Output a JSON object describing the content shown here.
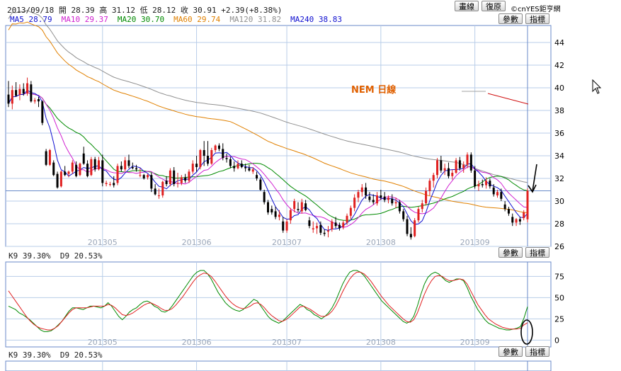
{
  "header": {
    "line1": "2013/09/18 開 28.39 高 31.12 低 28.12 收 30.91 +2.39(+8.38%)",
    "line2_items": [
      {
        "text": "MA5 28.79",
        "color": "#1010d0"
      },
      {
        "text": "MA10 29.37",
        "color": "#d020d0"
      },
      {
        "text": "MA20 30.70",
        "color": "#008a00"
      },
      {
        "text": "MA60 29.74",
        "color": "#e08000"
      },
      {
        "text": "MA120 31.82",
        "color": "#909090"
      },
      {
        "text": "MA240 38.83",
        "color": "#1010d0"
      }
    ]
  },
  "toolbar": {
    "draw_label": "畫線",
    "restore_label": "復原",
    "copyright": "©cnYES鉅亨網"
  },
  "buttons": {
    "param_label": "參數",
    "indicator_label": "指標"
  },
  "kd_header": "K9 39.30%  D9 20.53%",
  "kd_header_bottom": "K9 39.30%  D9 20.53%",
  "colors": {
    "up": "#e02020",
    "down": "#000000",
    "ma5": "#1010d0",
    "ma10": "#d020d0",
    "ma20": "#008a00",
    "ma60": "#e08000",
    "ma120": "#909090",
    "k": "#008a00",
    "d": "#e02020",
    "hline": "#6a8ac8",
    "grid": "#b8cde8",
    "annotation": "#e06000"
  },
  "chart_data": [
    {
      "type": "candlestick",
      "title": "NEM 日線",
      "x_tick_labels": [
        "201305",
        "201306",
        "201307",
        "201308",
        "201309"
      ],
      "y_tick_labels": [
        26,
        28,
        30,
        32,
        34,
        36,
        38,
        40,
        42,
        44
      ],
      "ylim": [
        26,
        45.5
      ],
      "horizontal_line": 30.91,
      "ohlc": [
        [
          39.4,
          40.6,
          38.3,
          38.6
        ],
        [
          38.6,
          40.2,
          38.1,
          39.8
        ],
        [
          39.8,
          40.5,
          39.2,
          39.3
        ],
        [
          39.4,
          40.3,
          38.9,
          39.9
        ],
        [
          39.9,
          40.4,
          39.3,
          39.5
        ],
        [
          39.5,
          40.9,
          39.3,
          40.4
        ],
        [
          40.3,
          40.6,
          38.7,
          38.8
        ],
        [
          38.8,
          39.1,
          38.6,
          38.9
        ],
        [
          39.0,
          39.2,
          38.3,
          38.8
        ],
        [
          38.8,
          38.9,
          36.7,
          36.9
        ],
        [
          34.4,
          34.6,
          33.1,
          33.2
        ],
        [
          33.2,
          34.6,
          33.1,
          34.5
        ],
        [
          33.4,
          33.6,
          32.2,
          32.3
        ],
        [
          32.4,
          32.6,
          31.1,
          31.2
        ],
        [
          31.3,
          32.7,
          31.2,
          32.6
        ],
        [
          32.6,
          33.1,
          32.2,
          32.3
        ],
        [
          32.4,
          32.7,
          32.1,
          32.6
        ],
        [
          32.6,
          33.6,
          32.4,
          33.4
        ],
        [
          33.2,
          33.5,
          32.1,
          32.2
        ],
        [
          32.3,
          33.4,
          32.2,
          33.3
        ],
        [
          34.2,
          34.8,
          33.2,
          33.3
        ],
        [
          33.3,
          33.6,
          32.1,
          32.2
        ],
        [
          32.3,
          33.9,
          32.2,
          33.7
        ],
        [
          33.7,
          33.9,
          32.6,
          32.8
        ],
        [
          32.8,
          33.9,
          32.7,
          33.6
        ],
        [
          33.6,
          34.1,
          31.3,
          31.6
        ],
        [
          31.5,
          31.8,
          31.3,
          31.6
        ],
        [
          31.5,
          31.7,
          31.3,
          31.5
        ],
        [
          31.6,
          32.2,
          31.2,
          31.4
        ],
        [
          31.6,
          33.3,
          31.4,
          33.1
        ],
        [
          33.1,
          33.5,
          32.6,
          32.8
        ],
        [
          32.8,
          33.9,
          32.6,
          33.6
        ],
        [
          33.6,
          34.1,
          32.9,
          33.1
        ],
        [
          33.0,
          33.4,
          32.8,
          32.9
        ],
        [
          32.9,
          33.2,
          32.6,
          32.8
        ],
        [
          32.3,
          32.9,
          32.1,
          32.3
        ],
        [
          32.3,
          32.4,
          31.9,
          32.0
        ],
        [
          32.1,
          32.4,
          31.9,
          32.3
        ],
        [
          32.3,
          32.5,
          30.8,
          31.1
        ],
        [
          31.1,
          31.5,
          30.5,
          30.6
        ],
        [
          30.5,
          31.1,
          30.2,
          30.5
        ],
        [
          30.5,
          31.8,
          30.3,
          31.7
        ],
        [
          31.8,
          32.2,
          31.3,
          31.5
        ],
        [
          31.5,
          32.9,
          31.3,
          32.7
        ],
        [
          32.7,
          33.0,
          31.3,
          31.5
        ],
        [
          31.6,
          32.5,
          31.2,
          31.6
        ],
        [
          31.6,
          32.3,
          31.4,
          32.1
        ],
        [
          32.1,
          32.4,
          31.6,
          31.8
        ],
        [
          31.8,
          32.8,
          31.6,
          32.6
        ],
        [
          32.6,
          33.6,
          32.4,
          33.3
        ],
        [
          33.3,
          34.0,
          32.6,
          33.0
        ],
        [
          33.0,
          34.6,
          32.8,
          34.5
        ],
        [
          34.5,
          35.3,
          33.1,
          34.0
        ],
        [
          34.0,
          35.3,
          33.1,
          33.3
        ],
        [
          33.3,
          34.7,
          33.2,
          34.5
        ],
        [
          34.5,
          35.0,
          34.3,
          34.9
        ],
        [
          34.9,
          35.1,
          34.4,
          34.6
        ],
        [
          34.6,
          35.1,
          33.6,
          33.8
        ],
        [
          33.8,
          34.2,
          33.4,
          33.7
        ],
        [
          33.7,
          33.9,
          32.9,
          33.1
        ],
        [
          33.1,
          33.5,
          32.6,
          32.9
        ],
        [
          32.9,
          33.6,
          32.8,
          33.3
        ],
        [
          33.3,
          33.6,
          32.9,
          33.0
        ],
        [
          33.0,
          33.3,
          32.6,
          32.9
        ],
        [
          32.9,
          33.2,
          32.6,
          32.7
        ],
        [
          32.6,
          33.0,
          32.4,
          32.8
        ],
        [
          32.3,
          32.6,
          31.8,
          32.0
        ],
        [
          31.9,
          32.1,
          30.9,
          31.0
        ],
        [
          30.8,
          31.0,
          29.7,
          29.9
        ],
        [
          29.9,
          30.1,
          28.8,
          29.0
        ],
        [
          29.3,
          29.6,
          28.8,
          29.0
        ],
        [
          29.1,
          29.5,
          28.4,
          28.6
        ],
        [
          28.6,
          29.2,
          28.3,
          28.8
        ],
        [
          28.2,
          28.6,
          27.2,
          27.4
        ],
        [
          27.4,
          28.4,
          27.2,
          28.2
        ],
        [
          28.3,
          29.4,
          28.0,
          29.2
        ],
        [
          29.3,
          30.2,
          29.0,
          30.0
        ],
        [
          29.3,
          29.9,
          29.0,
          29.2
        ],
        [
          29.1,
          30.2,
          28.9,
          29.9
        ],
        [
          29.8,
          30.1,
          29.1,
          29.2
        ],
        [
          28.3,
          28.6,
          27.6,
          27.8
        ],
        [
          27.5,
          28.2,
          27.2,
          27.6
        ],
        [
          27.6,
          28.1,
          27.1,
          27.8
        ],
        [
          27.9,
          28.2,
          27.0,
          27.2
        ],
        [
          27.2,
          27.5,
          26.9,
          27.1
        ],
        [
          27.3,
          27.8,
          26.8,
          27.4
        ],
        [
          27.5,
          28.4,
          27.3,
          28.2
        ],
        [
          28.1,
          28.6,
          27.6,
          27.8
        ],
        [
          27.9,
          28.1,
          27.4,
          27.6
        ],
        [
          27.7,
          28.3,
          27.5,
          28.1
        ],
        [
          28.1,
          28.9,
          27.9,
          28.7
        ],
        [
          28.7,
          29.6,
          28.4,
          29.4
        ],
        [
          29.4,
          30.6,
          29.1,
          30.3
        ],
        [
          30.3,
          31.0,
          29.9,
          30.8
        ],
        [
          30.8,
          31.5,
          30.4,
          31.2
        ],
        [
          31.2,
          31.6,
          30.2,
          30.5
        ],
        [
          30.4,
          30.8,
          29.9,
          30.1
        ],
        [
          30.1,
          30.6,
          29.7,
          29.9
        ],
        [
          29.8,
          30.8,
          29.6,
          30.5
        ],
        [
          30.5,
          31.0,
          30.1,
          30.3
        ],
        [
          30.4,
          30.8,
          29.9,
          30.1
        ],
        [
          30.1,
          30.5,
          29.8,
          30.3
        ],
        [
          30.2,
          30.6,
          29.6,
          29.8
        ],
        [
          29.8,
          30.3,
          29.4,
          29.9
        ],
        [
          29.9,
          30.1,
          28.9,
          29.1
        ],
        [
          29.1,
          29.3,
          28.2,
          28.4
        ],
        [
          28.4,
          28.7,
          26.9,
          27.1
        ],
        [
          27.1,
          27.7,
          26.6,
          26.8
        ],
        [
          26.9,
          28.5,
          26.8,
          28.3
        ],
        [
          28.3,
          29.5,
          28.1,
          29.3
        ],
        [
          29.3,
          30.1,
          29.0,
          29.8
        ],
        [
          29.8,
          31.2,
          29.6,
          30.9
        ],
        [
          30.9,
          32.0,
          30.5,
          31.8
        ],
        [
          31.8,
          32.5,
          31.2,
          32.3
        ],
        [
          32.3,
          33.8,
          32.0,
          33.6
        ],
        [
          33.6,
          34.0,
          32.5,
          32.7
        ],
        [
          32.7,
          33.3,
          32.3,
          32.9
        ],
        [
          32.9,
          33.4,
          32.0,
          32.2
        ],
        [
          32.2,
          32.8,
          31.9,
          32.5
        ],
        [
          32.5,
          33.8,
          32.4,
          33.6
        ],
        [
          33.6,
          33.9,
          32.7,
          32.9
        ],
        [
          32.9,
          33.5,
          32.5,
          33.2
        ],
        [
          33.2,
          34.3,
          32.9,
          34.1
        ],
        [
          34.1,
          34.3,
          32.5,
          32.7
        ],
        [
          32.7,
          33.1,
          31.1,
          31.3
        ],
        [
          31.3,
          31.8,
          30.9,
          31.5
        ],
        [
          31.5,
          31.9,
          31.2,
          31.4
        ],
        [
          31.4,
          32.1,
          31.1,
          31.8
        ],
        [
          31.8,
          32.0,
          31.1,
          31.3
        ],
        [
          31.2,
          31.5,
          30.4,
          30.6
        ],
        [
          30.5,
          31.0,
          30.3,
          30.8
        ],
        [
          30.8,
          31.1,
          30.0,
          30.2
        ],
        [
          29.7,
          30.0,
          29.1,
          29.3
        ],
        [
          29.3,
          29.5,
          28.7,
          28.9
        ],
        [
          28.6,
          28.9,
          27.8,
          28.1
        ],
        [
          28.1,
          28.5,
          27.8,
          28.4
        ],
        [
          28.4,
          28.6,
          27.9,
          28.2
        ],
        [
          28.5,
          29.2,
          28.3,
          29.0
        ],
        [
          28.39,
          31.12,
          28.12,
          30.91
        ]
      ],
      "annotations": {
        "ma_lines_shown": [
          "MA5",
          "MA10",
          "MA20",
          "MA60",
          "MA120"
        ]
      }
    },
    {
      "type": "line",
      "title": "KD",
      "y_tick_labels": [
        0,
        25,
        50,
        75
      ],
      "ylim": [
        -8,
        92
      ],
      "series": [
        {
          "name": "K9",
          "values": [
            40,
            38,
            36,
            32,
            30,
            27,
            24,
            20,
            16,
            12,
            10,
            10,
            11,
            14,
            18,
            22,
            28,
            34,
            38,
            38,
            37,
            36,
            38,
            40,
            40,
            39,
            38,
            40,
            44,
            40,
            34,
            28,
            24,
            28,
            33,
            36,
            38,
            42,
            45,
            46,
            44,
            40,
            38,
            34,
            33,
            35,
            40,
            46,
            52,
            58,
            64,
            70,
            76,
            80,
            82,
            82,
            78,
            72,
            64,
            56,
            50,
            44,
            40,
            37,
            35,
            34,
            36,
            40,
            44,
            48,
            46,
            40,
            34,
            28,
            24,
            22,
            20,
            22,
            26,
            30,
            34,
            38,
            42,
            40,
            36,
            34,
            30,
            28,
            25,
            28,
            32,
            38,
            46,
            56,
            66,
            74,
            80,
            82,
            82,
            80,
            76,
            70,
            64,
            58,
            52,
            46,
            42,
            38,
            34,
            30,
            26,
            22,
            20,
            22,
            28,
            40,
            54,
            66,
            74,
            78,
            80,
            78,
            74,
            70,
            68,
            70,
            72,
            72,
            70,
            62,
            52,
            44,
            36,
            30,
            24,
            20,
            18,
            16,
            14,
            13,
            12,
            12,
            13,
            14,
            16,
            26,
            39.3
          ]
        },
        {
          "name": "D9",
          "values": [
            58,
            52,
            46,
            40,
            34,
            28,
            23,
            19,
            16,
            14,
            13,
            12,
            12,
            14,
            17,
            22,
            27,
            32,
            36,
            38,
            38,
            38,
            38,
            39,
            40,
            40,
            40,
            40,
            42,
            41,
            38,
            34,
            30,
            29,
            30,
            32,
            35,
            38,
            41,
            43,
            44,
            42,
            40,
            37,
            35,
            35,
            37,
            41,
            46,
            51,
            57,
            63,
            69,
            74,
            77,
            79,
            78,
            75,
            70,
            64,
            58,
            52,
            47,
            43,
            40,
            38,
            37,
            38,
            40,
            43,
            44,
            42,
            38,
            33,
            29,
            26,
            23,
            22,
            24,
            27,
            31,
            35,
            39,
            40,
            38,
            36,
            33,
            30,
            28,
            28,
            30,
            34,
            40,
            48,
            57,
            65,
            72,
            77,
            80,
            80,
            78,
            74,
            69,
            63,
            57,
            51,
            46,
            41,
            37,
            33,
            29,
            25,
            22,
            21,
            24,
            32,
            43,
            54,
            63,
            70,
            75,
            76,
            75,
            72,
            70,
            70,
            71,
            72,
            71,
            66,
            58,
            50,
            42,
            36,
            30,
            25,
            22,
            19,
            17,
            15,
            14,
            13,
            13,
            13,
            14,
            18,
            20.53
          ]
        }
      ]
    }
  ]
}
